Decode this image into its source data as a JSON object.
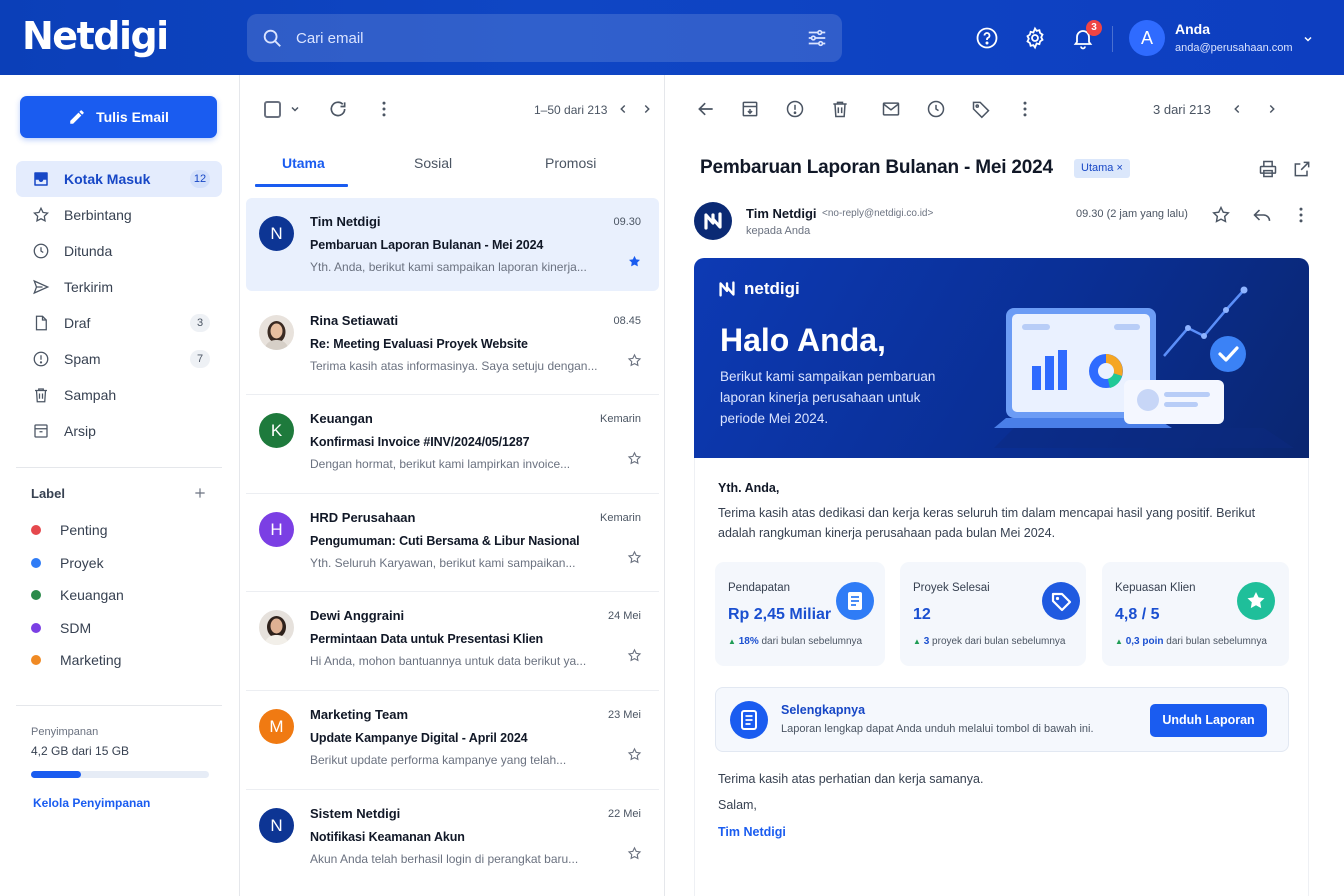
{
  "app": {
    "logo": "Netdigi"
  },
  "search": {
    "placeholder": "Cari email"
  },
  "header": {
    "notif_count": "3",
    "user_initial": "A",
    "user_name": "Anda",
    "user_email": "anda@perusahaan.com"
  },
  "sidebar": {
    "compose_label": "Tulis Email",
    "items": [
      {
        "label": "Kotak Masuk",
        "count": "12",
        "icon": "inbox-icon"
      },
      {
        "label": "Berbintang",
        "count": "",
        "icon": "star-icon"
      },
      {
        "label": "Ditunda",
        "count": "",
        "icon": "clock-icon"
      },
      {
        "label": "Terkirim",
        "count": "",
        "icon": "send-icon"
      },
      {
        "label": "Draf",
        "count": "3",
        "icon": "file-icon"
      },
      {
        "label": "Spam",
        "count": "7",
        "icon": "alert-icon"
      },
      {
        "label": "Sampah",
        "count": "",
        "icon": "trash-icon"
      },
      {
        "label": "Arsip",
        "count": "",
        "icon": "archive-icon"
      }
    ],
    "labels_title": "Label",
    "labels": [
      {
        "name": "Penting",
        "color": "#e5484d"
      },
      {
        "name": "Proyek",
        "color": "#2f7cf6"
      },
      {
        "name": "Keuangan",
        "color": "#2a8a4a"
      },
      {
        "name": "SDM",
        "color": "#7b3fe4"
      },
      {
        "name": "Marketing",
        "color": "#f08a24"
      }
    ],
    "storage": {
      "title": "Penyimpanan",
      "value": "4,2 GB dari 15 GB",
      "used_fraction": 0.28,
      "manage": "Kelola Penyimpanan"
    }
  },
  "list": {
    "range": "1–50 dari 213",
    "tabs": [
      "Utama",
      "Sosial",
      "Promosi"
    ],
    "emails": [
      {
        "from": "Tim Netdigi",
        "time": "09.30",
        "subject": "Pembaruan Laporan Bulanan - Mei 2024",
        "preview": "Yth. Anda, berikut kami sampaikan laporan kinerja...",
        "initial": "N",
        "color": "#0d3594",
        "starred": true
      },
      {
        "from": "Rina Setiawati",
        "time": "08.45",
        "subject": "Re: Meeting Evaluasi Proyek Website",
        "preview": "Terima kasih atas informasinya. Saya setuju dengan...",
        "initial": "",
        "color": "#c7a58a",
        "starred": false
      },
      {
        "from": "Keuangan",
        "time": "Kemarin",
        "subject": "Konfirmasi Invoice #INV/2024/05/1287",
        "preview": "Dengan hormat, berikut kami lampirkan invoice...",
        "initial": "K",
        "color": "#1e7a3c",
        "starred": false
      },
      {
        "from": "HRD Perusahaan",
        "time": "Kemarin",
        "subject": "Pengumuman: Cuti Bersama & Libur Nasional",
        "preview": "Yth. Seluruh Karyawan, berikut kami sampaikan...",
        "initial": "H",
        "color": "#7b3fe4",
        "starred": false
      },
      {
        "from": "Dewi Anggraini",
        "time": "24 Mei",
        "subject": "Permintaan Data untuk Presentasi Klien",
        "preview": "Hi Anda, mohon bantuannya untuk data berikut ya...",
        "initial": "",
        "color": "#a47a5e",
        "starred": false
      },
      {
        "from": "Marketing Team",
        "time": "23 Mei",
        "subject": "Update Kampanye Digital - April 2024",
        "preview": "Berikut update performa kampanye yang telah...",
        "initial": "M",
        "color": "#f07a12",
        "starred": false
      },
      {
        "from": "Sistem Netdigi",
        "time": "22 Mei",
        "subject": "Notifikasi Keamanan Akun",
        "preview": "Akun Anda telah berhasil login di perangkat baru...",
        "initial": "N",
        "color": "#0d3594",
        "starred": false
      }
    ]
  },
  "reader": {
    "range": "3 dari 213",
    "title": "Pembaruan Laporan Bulanan - Mei 2024",
    "tag": "Utama",
    "sender_name": "Tim Netdigi",
    "sender_email": "<no-reply@netdigi.co.id>",
    "to": "kepada Anda",
    "time": "09.30 (2 jam yang lalu)",
    "banner": {
      "brand": "netdigi",
      "hello": "Halo Anda,",
      "text": "Berikut kami sampaikan pembaruan laporan kinerja perusahaan untuk periode Mei 2024."
    },
    "greeting": "Yth. Anda,",
    "paragraph": "Terima kasih atas dedikasi dan kerja keras seluruh tim dalam mencapai hasil yang positif. Berikut adalah rangkuman kinerja perusahaan pada bulan Mei 2024.",
    "stats": [
      {
        "label": "Pendapatan",
        "value": "Rp 2,45 Miliar",
        "delta": "18%",
        "note": "dari bulan sebelumnya",
        "color": "#2f7cf6"
      },
      {
        "label": "Proyek Selesai",
        "value": "12",
        "delta": "3",
        "note": "proyek dari bulan sebelumnya",
        "color": "#1f5ae0"
      },
      {
        "label": "Kepuasan Klien",
        "value": "4,8 / 5",
        "delta": "0,3 poin",
        "note": "dari bulan sebelumnya",
        "color": "#1fbf9a"
      }
    ],
    "more": {
      "title": "Selengkapnya",
      "subtitle": "Laporan lengkap dapat Anda unduh melalui tombol di bawah ini.",
      "button": "Unduh Laporan"
    },
    "closing": "Terima kasih atas perhatian dan kerja samanya.",
    "salam": "Salam,",
    "signature": "Tim Netdigi"
  }
}
